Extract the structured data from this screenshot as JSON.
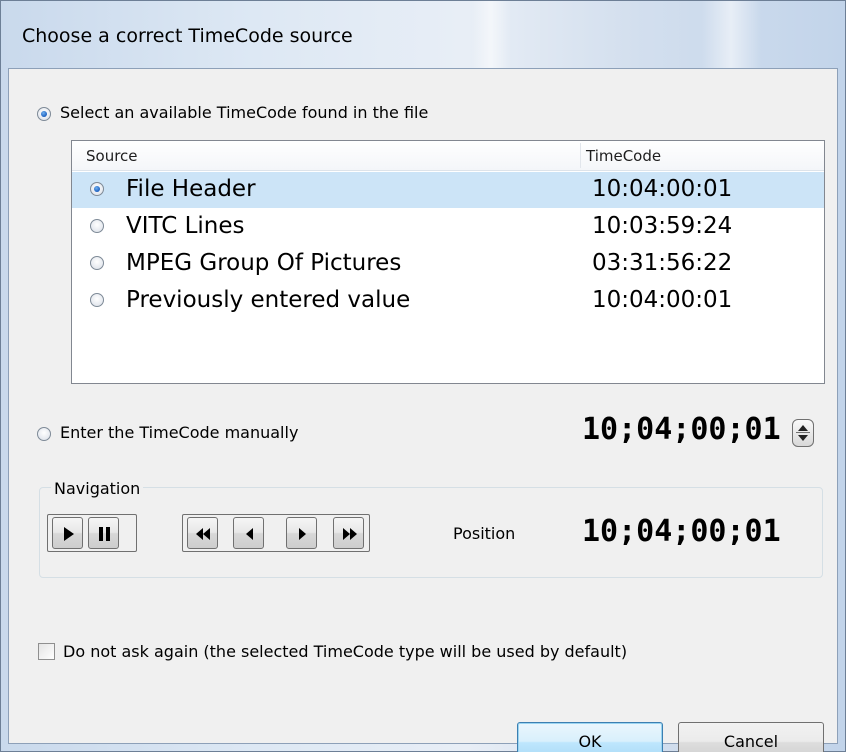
{
  "dialog": {
    "title": "Choose a correct TimeCode source"
  },
  "option_file": {
    "label": "Select an available TimeCode found in the file",
    "selected": true
  },
  "list": {
    "columns": [
      "Source",
      "TimeCode"
    ],
    "rows": [
      {
        "source": "File Header",
        "timecode": "10:04:00:01",
        "selected": true
      },
      {
        "source": "VITC Lines",
        "timecode": "10:03:59:24",
        "selected": false
      },
      {
        "source": "MPEG Group Of Pictures",
        "timecode": "03:31:56:22",
        "selected": false
      },
      {
        "source": "Previously entered value",
        "timecode": "10:04:00:01",
        "selected": false
      }
    ]
  },
  "option_manual": {
    "label": "Enter the TimeCode manually",
    "selected": false,
    "timecode": "10;04;00;01"
  },
  "navigation": {
    "group_label": "Navigation",
    "buttons": [
      "play-icon",
      "pause-icon",
      "rewind-icon",
      "step-back-icon",
      "step-forward-icon",
      "fast-forward-icon"
    ],
    "position_label": "Position",
    "position_value": "10;04;00;01"
  },
  "do_not_ask": {
    "label": "Do not ask again (the selected TimeCode type will be used by default)",
    "checked": false
  },
  "buttons": {
    "ok_label": "OK",
    "cancel_label": "Cancel"
  },
  "colors": {
    "selection": "#cce4f7",
    "radio_dot": "#1b5fbf",
    "default_button_border": "#3c7fb1"
  }
}
